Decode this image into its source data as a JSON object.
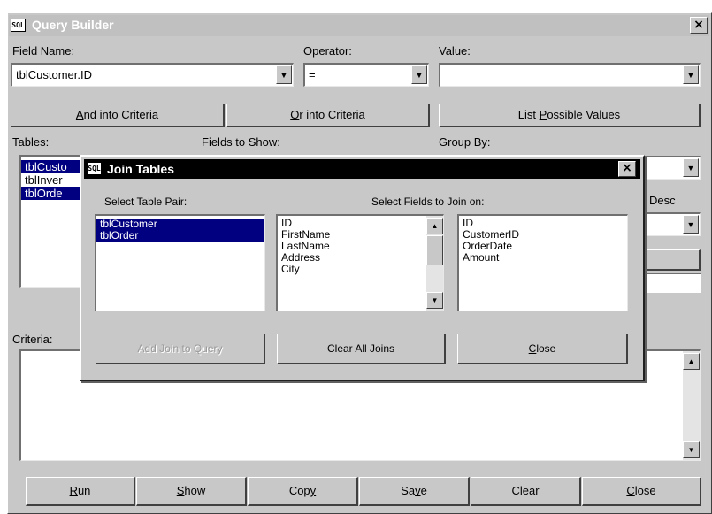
{
  "window": {
    "title": "Query Builder"
  },
  "labels": {
    "field_name": "Field Name:",
    "operator": "Operator:",
    "value": "Value:",
    "tables": "Tables:",
    "fields_to_show": "Fields to Show:",
    "group_by": "Group By:",
    "desc": "Desc",
    "criteria": "Criteria:"
  },
  "inputs": {
    "field_name_value": "tblCustomer.ID",
    "operator_value": "=",
    "value_value": ""
  },
  "criteria_buttons": {
    "and_prefix": "A",
    "and_rest": "nd into Criteria",
    "or_prefix": "O",
    "or_rest": "r into Criteria",
    "list_pre": "List ",
    "list_ul": "P",
    "list_post": "ossible Values"
  },
  "tables_list": [
    "tblCusto",
    "tblInver",
    "tblOrde"
  ],
  "bottom_buttons": {
    "run_ul": "R",
    "run_rest": "un",
    "show_ul": "S",
    "show_rest": "how",
    "copy_pre": "Cop",
    "copy_ul": "y",
    "save_pre": "Sa",
    "save_ul": "v",
    "save_post": "e",
    "clear": "Clear",
    "close_ul": "C",
    "close_rest": "lose"
  },
  "dialog": {
    "title": "Join Tables",
    "select_table_pair": "Select Table Pair:",
    "select_fields": "Select Fields to Join on:",
    "table_pairs": [
      "tblCustomer",
      "tblOrder"
    ],
    "left_fields": [
      "ID",
      "FirstName",
      "LastName",
      "Address",
      "City"
    ],
    "right_fields": [
      "ID",
      "CustomerID",
      "OrderDate",
      "Amount"
    ],
    "add_join": "Add Join to Query",
    "clear_all_joins": "Clear All Joins",
    "close_ul": "C",
    "close_rest": "lose"
  },
  "colors": {
    "selection": "#000080",
    "face": "#c8c8c8",
    "title_inactive": "#c0c0c0",
    "title_active": "#000000"
  },
  "icons": [
    "app-icon",
    "close-icon",
    "dropdown-arrow-icon",
    "scroll-up-icon",
    "scroll-down-icon"
  ]
}
